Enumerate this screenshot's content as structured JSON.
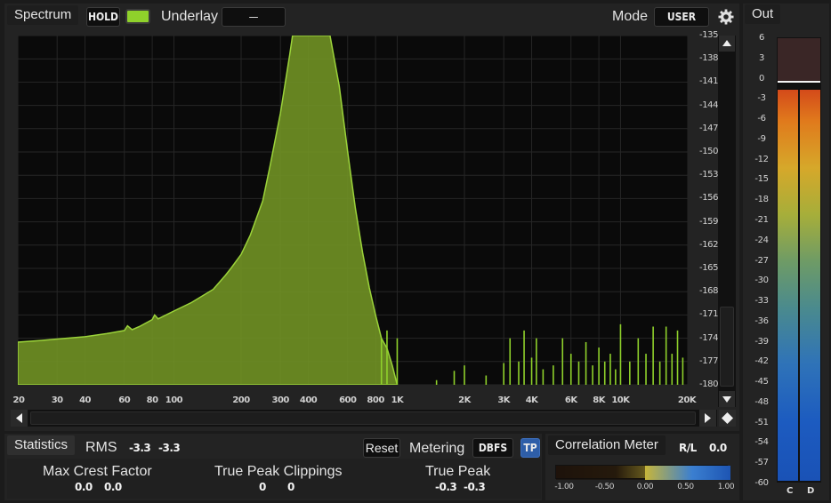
{
  "header": {
    "spectrum_tab": "Spectrum",
    "hold_button": "HOLD",
    "underlay_label": "Underlay",
    "underlay_value": "—",
    "mode_label": "Mode",
    "mode_value": "USER"
  },
  "spectrum": {
    "x_ticks": [
      "20",
      "30",
      "40",
      "60",
      "80",
      "100",
      "200",
      "300",
      "400",
      "600",
      "800",
      "1K",
      "2K",
      "3K",
      "4K",
      "6K",
      "8K",
      "10K",
      "20K"
    ],
    "y_ticks": [
      "-135",
      "-138",
      "-141",
      "-144",
      "-147",
      "-150",
      "-153",
      "-156",
      "-159",
      "-162",
      "-165",
      "-168",
      "-171",
      "-174",
      "-177",
      "-180"
    ]
  },
  "chart_data": {
    "type": "area",
    "x_scale": "log",
    "xlim": [
      20,
      20000
    ],
    "ylim": [
      -180,
      -135
    ],
    "xlabel": "",
    "ylabel": "",
    "series": [
      {
        "x": [
          20,
          25,
          30,
          40,
          50,
          60,
          62,
          65,
          70,
          80,
          82,
          85,
          100,
          120,
          150,
          170,
          180,
          200,
          220,
          250,
          270,
          300,
          330,
          340,
          350,
          380,
          400,
          410,
          440,
          480,
          500,
          550,
          600,
          650,
          700,
          750,
          800,
          850,
          900,
          950,
          1000
        ],
        "y": [
          -174.5,
          -174.3,
          -174.1,
          -173.8,
          -173.4,
          -173.0,
          -172.4,
          -172.9,
          -172.5,
          -171.6,
          -171.0,
          -171.5,
          -170.5,
          -169.4,
          -167.7,
          -165.9,
          -165.0,
          -163.2,
          -160.7,
          -156.3,
          -151.7,
          -145.0,
          -137.5,
          -135.0,
          -135.0,
          -135.0,
          -135.0,
          -135.0,
          -135.0,
          -135.0,
          -135.0,
          -141.5,
          -150.0,
          -157.3,
          -163.0,
          -167.5,
          -171.0,
          -174.0,
          -175.3,
          -177.5,
          -180.0
        ]
      },
      {
        "name": "",
        "type": "spikes",
        "x": [
          850,
          900,
          1000,
          1500,
          1800,
          2000,
          2500,
          3000,
          3200,
          3500,
          3700,
          4000,
          4200,
          4500,
          5000,
          5500,
          6000,
          6500,
          7000,
          7500,
          8000,
          8500,
          9000,
          9500,
          10000,
          11000,
          12000,
          13000,
          14000,
          15000,
          16000,
          17000,
          18000,
          19000
        ],
        "y": [
          -174.0,
          -173.0,
          -174.0,
          -179.4,
          -178.2,
          -177.5,
          -178.8,
          -177.2,
          -174.0,
          -177.0,
          -173.0,
          -176.5,
          -174.0,
          -178.0,
          -177.5,
          -174.0,
          -176.0,
          -177.0,
          -174.5,
          -177.5,
          -175.2,
          -177.0,
          -176.0,
          -178.0,
          -172.2,
          -177.0,
          -174.0,
          -176.0,
          -172.5,
          -177.0,
          -172.5,
          -176.0,
          -173.0,
          -176.5
        ]
      }
    ]
  },
  "statistics": {
    "tab": "Statistics",
    "rms_label": "RMS",
    "rms_left": "-3.3",
    "rms_right": "-3.3",
    "reset_button": "Reset",
    "metering_label": "Metering",
    "metering_value": "DBFS",
    "tp_button": "TP",
    "crest_label": "Max Crest Factor",
    "crest_left": "0.0",
    "crest_right": "0.0",
    "clippings_label": "True Peak Clippings",
    "clippings_left": "0",
    "clippings_right": "0",
    "truepeak_label": "True Peak",
    "truepeak_left": "-0.3",
    "truepeak_right": "-0.3"
  },
  "correlation": {
    "tab": "Correlation Meter",
    "mode": "R/L",
    "value": "0.0",
    "ticks": [
      "-1.00",
      "-0.50",
      "0.00",
      "0.50",
      "1.00"
    ]
  },
  "out": {
    "tab": "Out",
    "ticks": [
      "6",
      "3",
      "0",
      "-3",
      "-6",
      "-9",
      "-12",
      "-15",
      "-18",
      "-21",
      "-24",
      "-27",
      "-30",
      "-33",
      "-36",
      "-39",
      "-42",
      "-45",
      "-48",
      "-51",
      "-54",
      "-57",
      "-60"
    ],
    "channel_left": "C",
    "channel_right": "D",
    "level_db": -3.3,
    "peak_db": -0.3
  },
  "colors": {
    "accent_green": "#8fd12b",
    "spectrum_fill": "#6f8f24",
    "tp_active": "#2e5ea8"
  }
}
